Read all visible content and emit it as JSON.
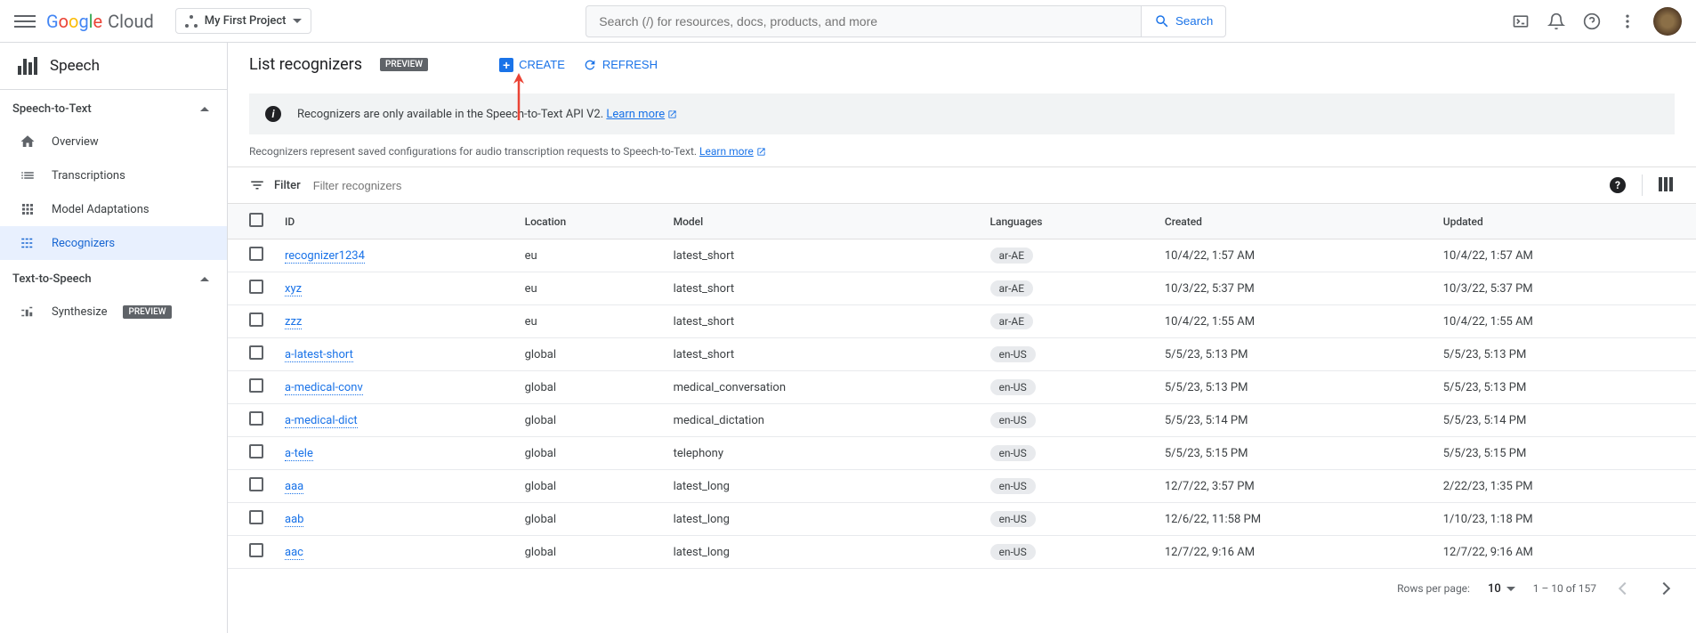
{
  "header": {
    "logo_text_google": "Google",
    "logo_text_cloud": "Cloud",
    "project_name": "My First Project",
    "search_placeholder": "Search (/) for resources, docs, products, and more",
    "search_button": "Search"
  },
  "sidebar": {
    "product_title": "Speech",
    "groups": [
      {
        "label": "Speech-to-Text",
        "items": [
          {
            "label": "Overview",
            "icon": "home"
          },
          {
            "label": "Transcriptions",
            "icon": "list"
          },
          {
            "label": "Model Adaptations",
            "icon": "apps"
          },
          {
            "label": "Recognizers",
            "icon": "grid",
            "active": true
          }
        ]
      },
      {
        "label": "Text-to-Speech",
        "items": [
          {
            "label": "Synthesize",
            "icon": "synth",
            "badge": "PREVIEW"
          }
        ]
      }
    ]
  },
  "content": {
    "title": "List recognizers",
    "title_badge": "PREVIEW",
    "create_label": "CREATE",
    "refresh_label": "REFRESH",
    "info_banner": "Recognizers are only available in the Speech-to-Text API V2.",
    "info_learn_more": "Learn more",
    "helper_text": "Recognizers represent saved configurations for audio transcription requests to Speech-to-Text.",
    "helper_learn_more": "Learn more",
    "filter_label": "Filter",
    "filter_placeholder": "Filter recognizers"
  },
  "table": {
    "columns": [
      "ID",
      "Location",
      "Model",
      "Languages",
      "Created",
      "Updated"
    ],
    "rows": [
      {
        "id": "recognizer1234",
        "location": "eu",
        "model": "latest_short",
        "lang": "ar-AE",
        "created": "10/4/22, 1:57 AM",
        "updated": "10/4/22, 1:57 AM"
      },
      {
        "id": "xyz",
        "location": "eu",
        "model": "latest_short",
        "lang": "ar-AE",
        "created": "10/3/22, 5:37 PM",
        "updated": "10/3/22, 5:37 PM"
      },
      {
        "id": "zzz",
        "location": "eu",
        "model": "latest_short",
        "lang": "ar-AE",
        "created": "10/4/22, 1:55 AM",
        "updated": "10/4/22, 1:55 AM"
      },
      {
        "id": "a-latest-short",
        "location": "global",
        "model": "latest_short",
        "lang": "en-US",
        "created": "5/5/23, 5:13 PM",
        "updated": "5/5/23, 5:13 PM"
      },
      {
        "id": "a-medical-conv",
        "location": "global",
        "model": "medical_conversation",
        "lang": "en-US",
        "created": "5/5/23, 5:13 PM",
        "updated": "5/5/23, 5:13 PM"
      },
      {
        "id": "a-medical-dict",
        "location": "global",
        "model": "medical_dictation",
        "lang": "en-US",
        "created": "5/5/23, 5:14 PM",
        "updated": "5/5/23, 5:14 PM"
      },
      {
        "id": "a-tele",
        "location": "global",
        "model": "telephony",
        "lang": "en-US",
        "created": "5/5/23, 5:15 PM",
        "updated": "5/5/23, 5:15 PM"
      },
      {
        "id": "aaa",
        "location": "global",
        "model": "latest_long",
        "lang": "en-US",
        "created": "12/7/22, 3:57 PM",
        "updated": "2/22/23, 1:35 PM"
      },
      {
        "id": "aab",
        "location": "global",
        "model": "latest_long",
        "lang": "en-US",
        "created": "12/6/22, 11:58 PM",
        "updated": "1/10/23, 1:18 PM"
      },
      {
        "id": "aac",
        "location": "global",
        "model": "latest_long",
        "lang": "en-US",
        "created": "12/7/22, 9:16 AM",
        "updated": "12/7/22, 9:16 AM"
      }
    ]
  },
  "pagination": {
    "rows_label": "Rows per page:",
    "rows_value": "10",
    "range": "1 – 10 of 157"
  }
}
